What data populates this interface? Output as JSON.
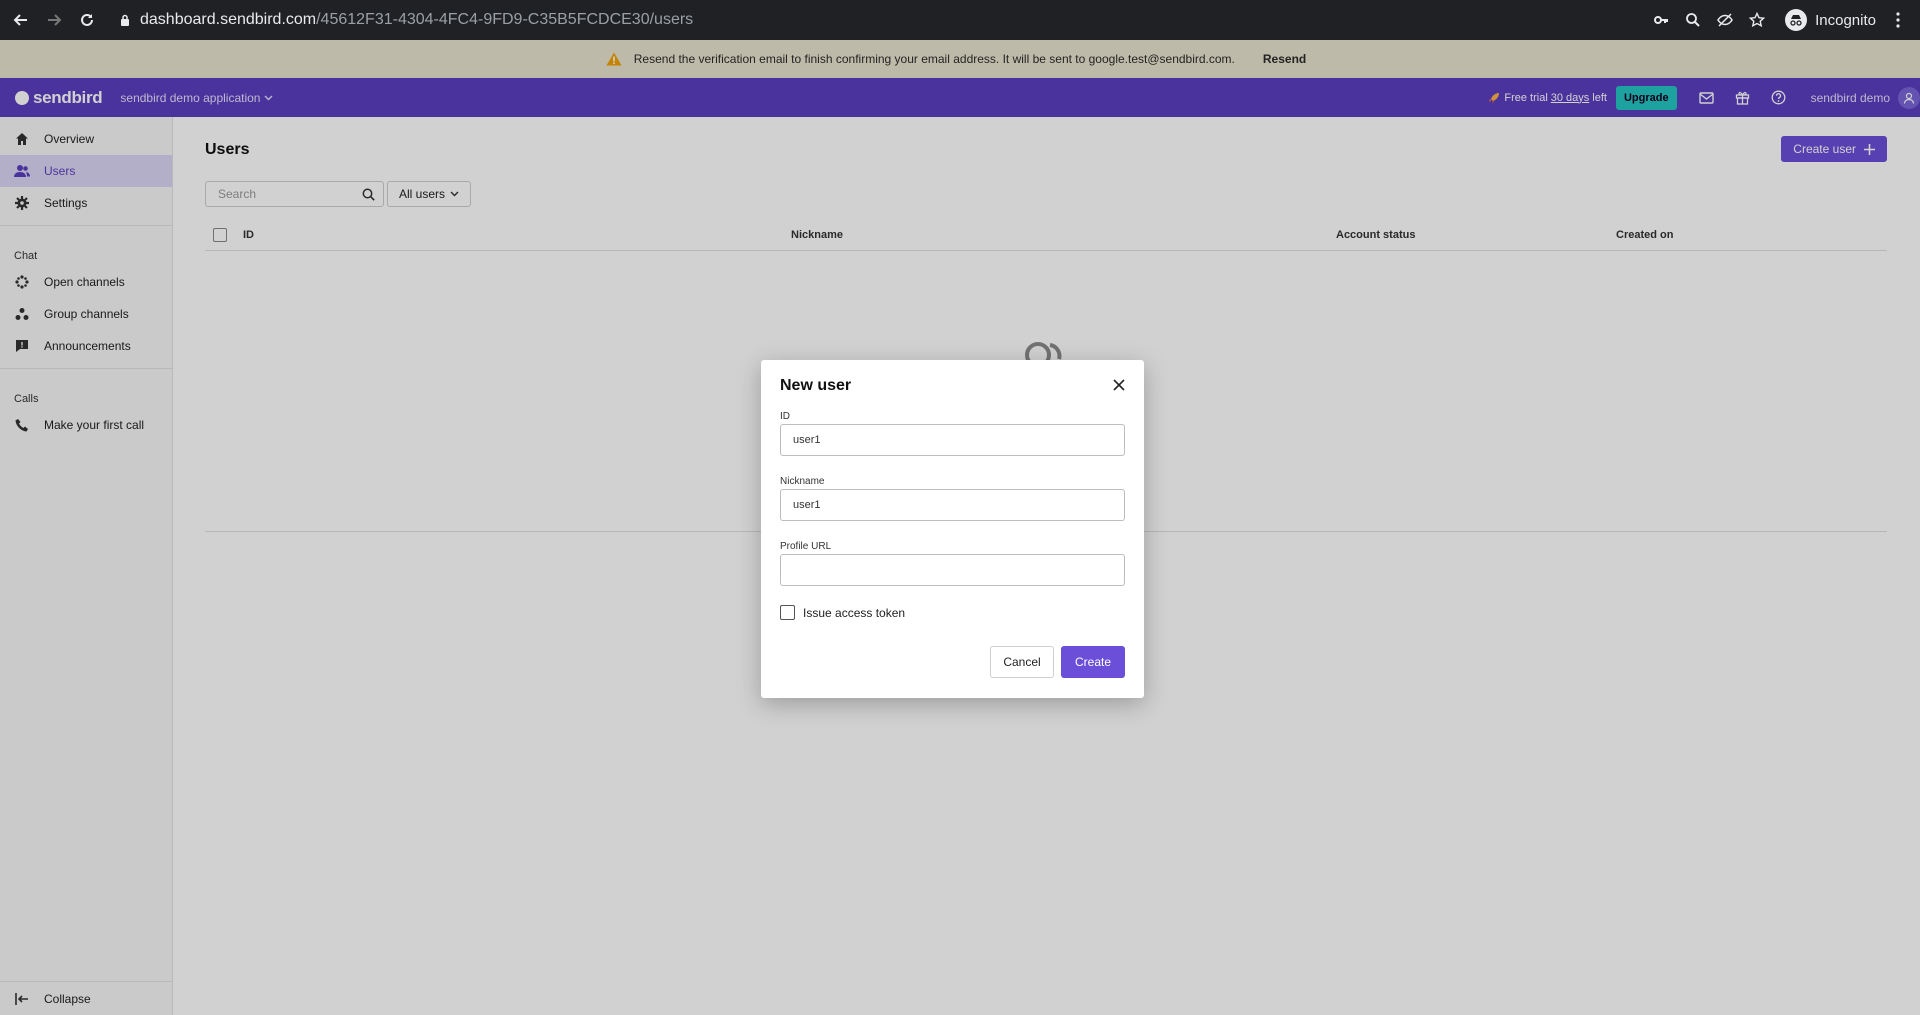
{
  "browser": {
    "url_host": "dashboard.sendbird.com",
    "url_path": "/45612F31-4304-4FC4-9FD9-C35B5FCDCE30/users",
    "profile_label": "Incognito"
  },
  "banner": {
    "message": "Resend the verification email to finish confirming your email address. It will be sent to google.test@sendbird.com.",
    "action_label": "Resend"
  },
  "topbar": {
    "logo_text": "sendbird",
    "app_name": "sendbird demo application",
    "trial_prefix": "Free trial",
    "trial_days": "30 days",
    "trial_suffix": "left",
    "upgrade_label": "Upgrade",
    "account_name": "sendbird demo"
  },
  "sidebar": {
    "items": [
      {
        "label": "Overview",
        "icon": "home-icon"
      },
      {
        "label": "Users",
        "icon": "users-icon"
      },
      {
        "label": "Settings",
        "icon": "gear-icon"
      }
    ],
    "chat_group": "Chat",
    "chat_items": [
      {
        "label": "Open channels",
        "icon": "open-channels-icon"
      },
      {
        "label": "Group channels",
        "icon": "group-channels-icon"
      },
      {
        "label": "Announcements",
        "icon": "announcements-icon"
      }
    ],
    "calls_group": "Calls",
    "calls_items": [
      {
        "label": "Make your first call",
        "icon": "phone-icon"
      }
    ],
    "collapse_label": "Collapse"
  },
  "main": {
    "title": "Users",
    "create_button": "Create user",
    "search_placeholder": "Search",
    "filter_label": "All users",
    "columns": [
      "ID",
      "Nickname",
      "Account status",
      "Created on"
    ]
  },
  "modal": {
    "title": "New user",
    "id_label": "ID",
    "id_value": "user1",
    "nickname_label": "Nickname",
    "nickname_value": "user1",
    "profile_url_label": "Profile URL",
    "profile_url_value": "",
    "token_label": "Issue access token",
    "cancel_label": "Cancel",
    "create_label": "Create"
  },
  "colors": {
    "brand": "#5b3fbf",
    "button": "#6b4fd8",
    "upgrade": "#25c6c2",
    "banner": "#e8e3cf"
  }
}
